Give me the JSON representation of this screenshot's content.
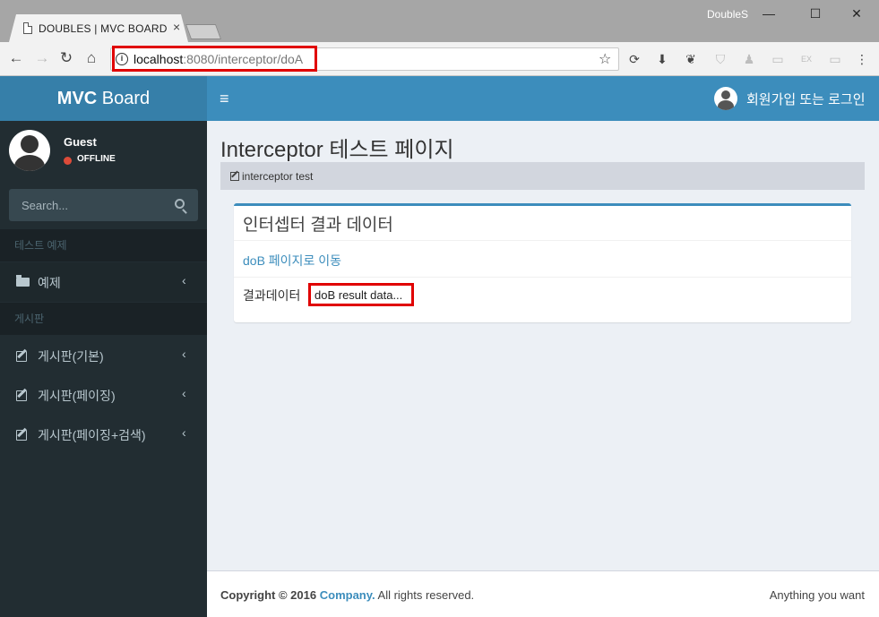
{
  "browser": {
    "tab_title": "DOUBLES | MVC BOARD",
    "tab_close": "×",
    "window_user": "DoubleS",
    "window_buttons": {
      "minimize": "—",
      "maximize": "☐",
      "close": "✕"
    },
    "nav": {
      "back": "←",
      "forward": "→",
      "reload": "↻",
      "home": "⌂"
    },
    "info_glyph": "i",
    "url_host": "localhost",
    "url_rest": ":8080/interceptor/doA",
    "star_glyph": "☆",
    "extensions": [
      "sync-icon",
      "download-icon",
      "gnome-icon",
      "shield-icon",
      "user-icon",
      "screen-icon",
      "ex-icon",
      "flag-icon",
      "menu-icon"
    ],
    "extension_glyphs": [
      "⟳",
      "⬇",
      "❦",
      "⛉",
      "♟",
      "▭",
      "EX",
      "▭",
      "⋮"
    ]
  },
  "header": {
    "logo_bold": "MVC",
    "logo_rest": " Board",
    "hamburger": "≡",
    "login_text": "회원가입 또는 로그인"
  },
  "sidebar": {
    "user_name": "Guest",
    "status": "OFFLINE",
    "search_placeholder": "Search...",
    "sections": [
      {
        "header": "테스트 예제"
      },
      {
        "header": "게시판"
      }
    ],
    "items": [
      {
        "label": "예제",
        "icon": "folder-icon"
      },
      {
        "label": "게시판(기본)",
        "icon": "edit-icon"
      },
      {
        "label": "게시판(페이징)",
        "icon": "edit-icon"
      },
      {
        "label": "게시판(페이징+검색)",
        "icon": "edit-icon"
      }
    ],
    "chevron": "‹"
  },
  "content": {
    "title": "Interceptor 테스트 페이지",
    "breadcrumb": "interceptor test",
    "box_title": "인터셉터 결과 데이터",
    "link_text": "doB 페이지로 이동",
    "result_label": "결과데이터",
    "result_value": "doB result data..."
  },
  "footer": {
    "copyright": "Copyright © 2016",
    "company": "Company.",
    "rights": " All rights reserved.",
    "right_text": "Anything you want"
  },
  "colors": {
    "accent": "#3c8dbc",
    "logo_bg": "#367fa9",
    "sidebar_bg": "#222d32",
    "highlight": "#e00000"
  }
}
